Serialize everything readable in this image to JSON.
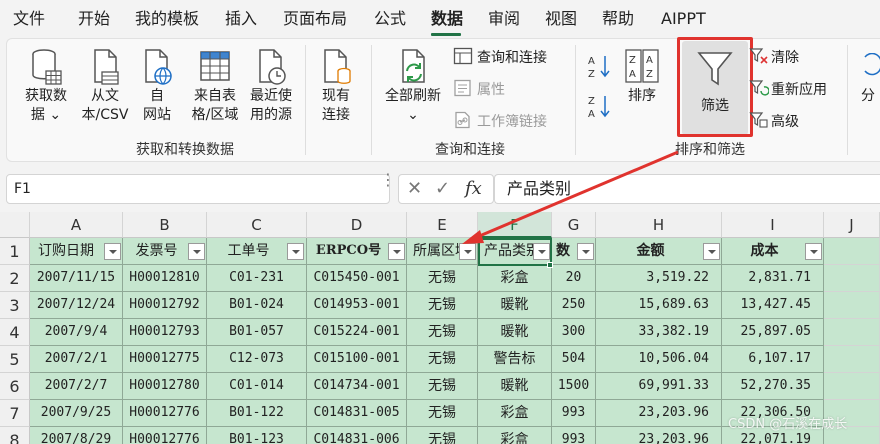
{
  "menu": {
    "items": [
      "文件",
      "开始",
      "我的模板",
      "插入",
      "页面布局",
      "公式",
      "数据",
      "审阅",
      "视图",
      "帮助",
      "AIPPT"
    ],
    "active": "数据"
  },
  "ribbon": {
    "get_data": {
      "line1": "获取数",
      "line2": "据"
    },
    "from_text": {
      "line1": "从文",
      "line2": "本/CSV"
    },
    "from_web": {
      "line1": "自",
      "line2": "网站"
    },
    "from_table": {
      "line1": "来自表",
      "line2": "格/区域"
    },
    "recent_sources": {
      "line1": "最近使",
      "line2": "用的源"
    },
    "existing_connections": {
      "line1": "现有",
      "line2": "连接"
    },
    "group_get_transform": "获取和转换数据",
    "refresh_all": "全部刷新",
    "queries_connections": "查询和连接",
    "properties": "属性",
    "workbook_links": "工作簿链接",
    "group_queries": "查询和连接",
    "sort": "排序",
    "filter": "筛选",
    "clear": "清除",
    "reapply": "重新应用",
    "advanced": "高级",
    "group_sort_filter": "排序和筛选",
    "partial_cut": "分"
  },
  "formula_bar": {
    "name_box": "F1",
    "formula": "产品类别"
  },
  "sheet": {
    "columns": [
      "A",
      "B",
      "C",
      "D",
      "E",
      "F",
      "G",
      "H",
      "I",
      "J"
    ],
    "selected_column": "F",
    "rows": [
      "1",
      "2",
      "3",
      "4",
      "5",
      "6",
      "7",
      "8"
    ],
    "header": [
      "订购日期",
      "发票号",
      "工单号",
      "ERPCO号",
      "所属区域",
      "产品类别",
      "数",
      "金额",
      "成本"
    ],
    "data": [
      [
        "2007/11/15",
        "H00012810",
        "C01-231",
        "C015450-001",
        "无锡",
        "彩盒",
        "20",
        "3,519.22",
        "2,831.71"
      ],
      [
        "2007/12/24",
        "H00012792",
        "B01-024",
        "C014953-001",
        "无锡",
        "暖靴",
        "250",
        "15,689.63",
        "13,427.45"
      ],
      [
        "2007/9/4",
        "H00012793",
        "B01-057",
        "C015224-001",
        "无锡",
        "暖靴",
        "300",
        "33,382.19",
        "25,897.05"
      ],
      [
        "2007/2/1",
        "H00012775",
        "C12-073",
        "C015100-001",
        "无锡",
        "警告标",
        "504",
        "10,506.04",
        "6,107.17"
      ],
      [
        "2007/2/7",
        "H00012780",
        "C01-014",
        "C014734-001",
        "无锡",
        "暖靴",
        "1500",
        "69,991.33",
        "52,270.35"
      ],
      [
        "2007/9/25",
        "H00012776",
        "B01-122",
        "C014831-005",
        "无锡",
        "彩盒",
        "993",
        "23,203.96",
        "22,306.50"
      ],
      [
        "2007/8/29",
        "H00012776",
        "B01-123",
        "C014831-006",
        "无锡",
        "彩盒",
        "993",
        "23,203.96",
        "22,071.19"
      ]
    ]
  },
  "watermark": "CSDN @石溪在成长",
  "colors": {
    "accent": "#217346",
    "highlight": "#e0332e",
    "cell_fill": "#c6e6cf"
  }
}
